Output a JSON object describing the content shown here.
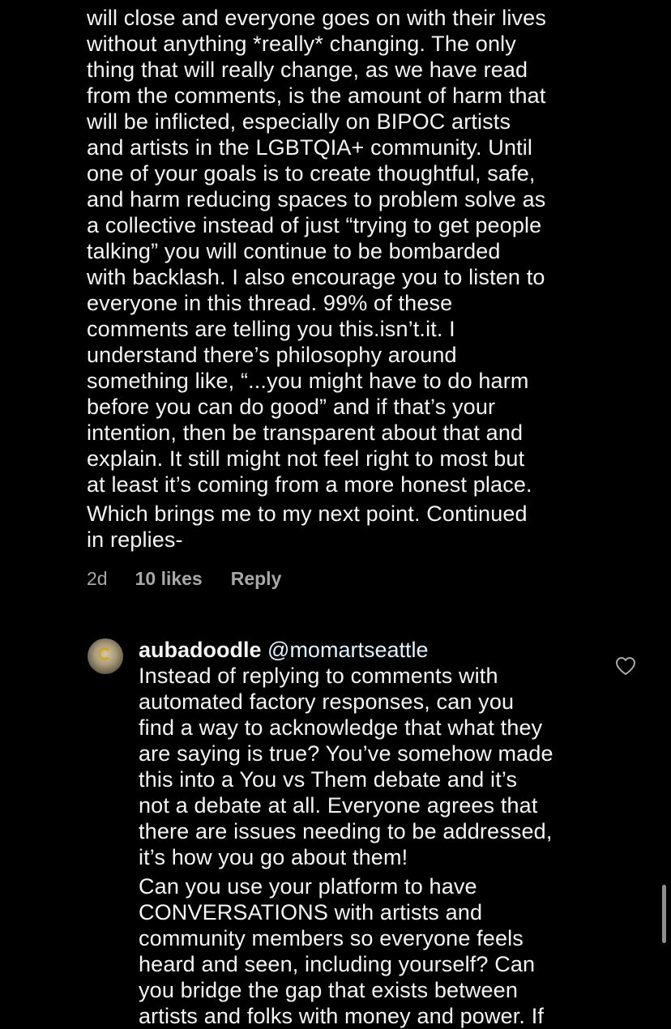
{
  "comment_one": {
    "text": "someone wanted to be heard and the conversation\nwill close and everyone goes on with their lives\nwithout anything *really* changing. The only\nthing that will really change, as we have read\nfrom the comments, is the amount of harm that\nwill be inflicted, especially on BIPOC artists\nand artists in the LGBTQIA+ community. Until\none of your goals is to create thoughtful, safe,\nand harm reducing spaces to problem solve as\na collective instead of just “trying to get people\ntalking” you will continue to be bombarded\nwith backlash. I also encourage you to listen to\neveryone in this thread. 99% of these\ncomments are telling you this.isn’t.it. I\nunderstand there’s philosophy around\nsomething like, “...you might have to do harm\nbefore you can do good” and if that’s your\nintention, then be transparent about that and\nexplain. It still might not feel right to most but\nat least it’s coming from a more honest place.",
    "continued": "Which brings me to my next point. Continued\nin replies-",
    "time": "2d",
    "likes": "10 likes",
    "reply_label": "Reply"
  },
  "reply_comment": {
    "username": "aubadoodle",
    "mention": "@momartseattle",
    "paragraph1": "Instead of replying to comments with\nautomated factory responses, can you\nfind a way to acknowledge that what they\nare saying is true? You’ve somehow made\nthis into a You vs Them debate and it’s\nnot a debate at all. Everyone agrees that\nthere are issues needing to be addressed,\nit’s how you go about them!",
    "paragraph2": "Can you use your platform to have\nCONVERSATIONS with artists and\ncommunity members so everyone feels\nheard and seen, including yourself? Can\nyou bridge the gap that exists between\nartists and folks with money and power. If",
    "like_icon": "heart-outline-icon"
  },
  "colors": {
    "background": "#000000",
    "text": "#f5f5f5",
    "meta": "#a8a8a8"
  }
}
